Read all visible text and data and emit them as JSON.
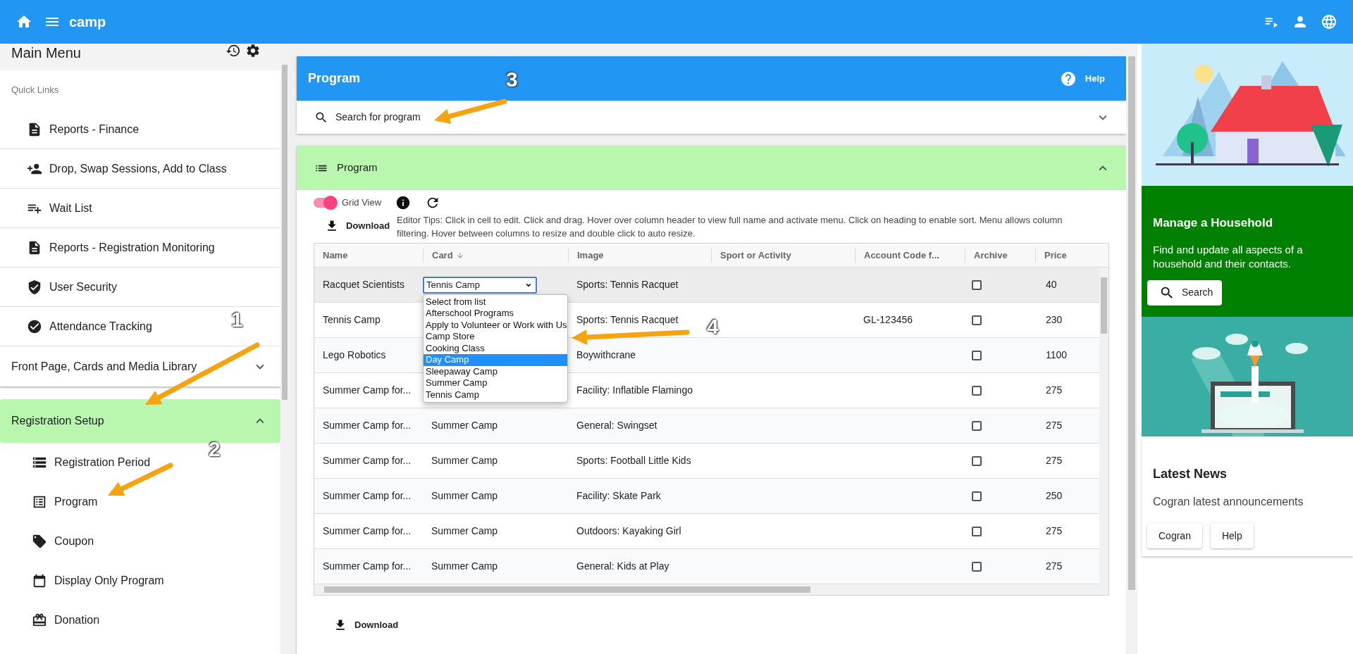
{
  "top_bar": {
    "title": "camp"
  },
  "sidebar": {
    "title": "Main Menu",
    "quick_links_label": "Quick Links",
    "quick_links": [
      {
        "label": "Reports - Finance"
      },
      {
        "label": "Drop, Swap Sessions, Add to Class"
      },
      {
        "label": "Wait List"
      },
      {
        "label": "Reports - Registration Monitoring"
      },
      {
        "label": "User Security"
      },
      {
        "label": "Attendance Tracking"
      }
    ],
    "sections": [
      {
        "label": "Front Page, Cards and Media Library",
        "expanded": false
      },
      {
        "label": "Registration Setup",
        "expanded": true,
        "items": [
          {
            "label": "Registration Period"
          },
          {
            "label": "Program"
          },
          {
            "label": "Coupon"
          },
          {
            "label": "Display Only Program"
          },
          {
            "label": "Donation"
          }
        ]
      }
    ]
  },
  "program_panel": {
    "title": "Program",
    "help": "Help",
    "search_title": "Search for program",
    "search_expanded": false
  },
  "grid_section": {
    "title": "Program",
    "expanded": true,
    "grid_view": {
      "label": "Grid View",
      "on": true
    },
    "download": "Download",
    "tips": "Editor Tips: Click in cell to edit. Click and drag. Hover over column header to view full name and activate menu. Click on heading to enable sort. Menu allows column filtering. Hover between columns to resize and double click to auto resize.",
    "table": {
      "columns": [
        "Name",
        "Card",
        "Image",
        "Sport or Activity",
        "Account Code f...",
        "Archive",
        "Price"
      ],
      "rows": [
        {
          "name": "Racquet Scientists",
          "card": "Tennis Camp",
          "image": "Sports: Tennis Racquet",
          "archived": false,
          "price": "40",
          "selected": true,
          "editing": true
        },
        {
          "name": "Tennis Camp",
          "image": "Sports: Tennis Racquet",
          "account": "GL-123456",
          "archived": false,
          "price": "230",
          "selected": false,
          "editing": false
        },
        {
          "name": "Lego Robotics",
          "image": "Boywithcrane",
          "archived": false,
          "price": "1100",
          "selected": false,
          "editing": false
        },
        {
          "name": "Summer Camp for...",
          "image": "Facility: Inflatible Flamingo",
          "archived": false,
          "price": "275",
          "selected": false,
          "editing": false
        },
        {
          "name": "Summer Camp for...",
          "card": "Summer Camp",
          "image": "General: Swingset",
          "archived": false,
          "price": "275",
          "selected": false,
          "editing": false
        },
        {
          "name": "Summer Camp for...",
          "card": "Summer Camp",
          "image": "Sports: Football Little Kids",
          "archived": false,
          "price": "275",
          "selected": false,
          "editing": false
        },
        {
          "name": "Summer Camp for...",
          "card": "Summer Camp",
          "image": "Facility: Skate Park",
          "archived": false,
          "price": "250",
          "selected": false,
          "editing": false
        },
        {
          "name": "Summer Camp for...",
          "card": "Summer Camp",
          "image": "Outdoors: Kayaking Girl",
          "archived": false,
          "price": "275",
          "selected": false,
          "editing": false
        },
        {
          "name": "Summer Camp for...",
          "card": "Summer Camp",
          "image": "General: Kids at Play",
          "archived": false,
          "price": "275",
          "selected": false,
          "editing": false
        }
      ],
      "card_options": [
        {
          "label": "Select from list",
          "selected": false
        },
        {
          "label": "Afterschool Programs",
          "selected": false
        },
        {
          "label": "Apply to Volunteer or Work with Us",
          "selected": false
        },
        {
          "label": "Camp Store",
          "selected": false
        },
        {
          "label": "Cooking Class",
          "selected": false
        },
        {
          "label": "Day Camp",
          "selected": true
        },
        {
          "label": "Sleepaway Camp",
          "selected": false
        },
        {
          "label": "Summer Camp",
          "selected": false
        },
        {
          "label": "Tennis Camp",
          "selected": false
        }
      ]
    },
    "bottom_download": "Download"
  },
  "right_panel": {
    "household": {
      "title": "Manage a Household",
      "text": "Find and update all aspects of a household and their contacts.",
      "button": "Search"
    },
    "news": {
      "title": "Latest News",
      "text": "Cogran latest announcements",
      "buttons": [
        "Cogran",
        "Help"
      ]
    }
  },
  "annotations": [
    {
      "label": "1"
    },
    {
      "label": "2"
    },
    {
      "label": "3"
    },
    {
      "label": "4"
    }
  ]
}
